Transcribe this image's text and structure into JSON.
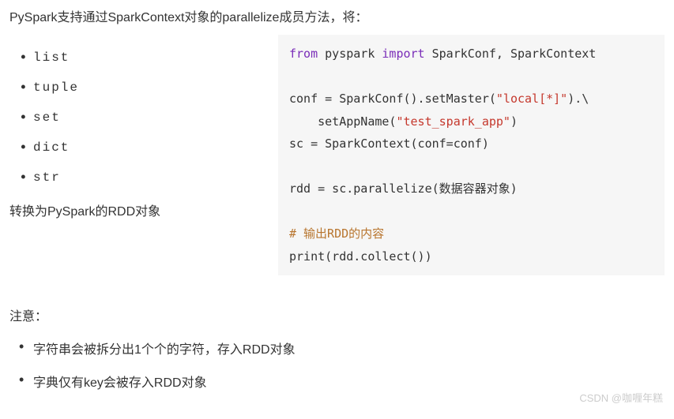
{
  "intro": "PySpark支持通过SparkContext对象的parallelize成员方法，将：",
  "types": [
    "list",
    "tuple",
    "set",
    "dict",
    "str"
  ],
  "convert_line": "转换为PySpark的RDD对象",
  "code": {
    "l1_from": "from",
    "l1_pkg": " pyspark ",
    "l1_import": "import",
    "l1_rest": " SparkConf, SparkContext",
    "l3a": "conf = SparkConf().setMaster(",
    "l3s": "\"local[*]\"",
    "l3b": ").\\",
    "l4a": "    setAppName(",
    "l4s": "\"test_spark_app\"",
    "l4b": ")",
    "l5": "sc = SparkContext(conf=conf)",
    "l7": "rdd = sc.parallelize(数据容器对象)",
    "l9": "# 输出RDD的内容",
    "l10a": "print",
    "l10b": "(rdd.collect())"
  },
  "note_title": "注意：",
  "notes": [
    "字符串会被拆分出1个个的字符，存入RDD对象",
    "字典仅有key会被存入RDD对象"
  ],
  "watermark": "CSDN @咖喱年糕"
}
